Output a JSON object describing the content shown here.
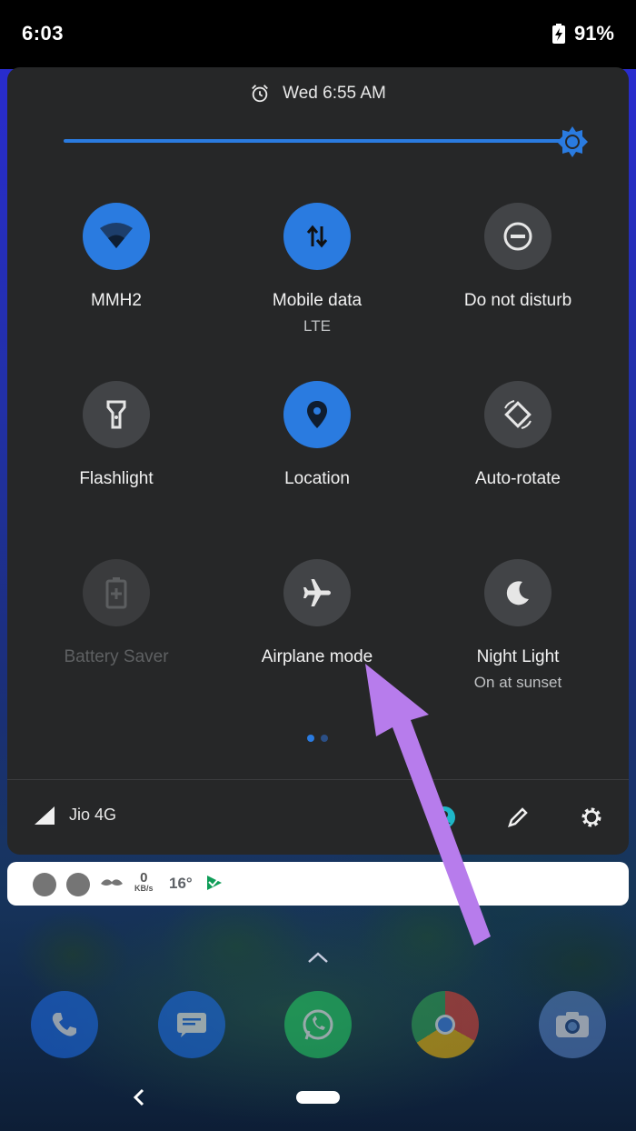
{
  "status_bar": {
    "time": "6:03",
    "battery": "91%"
  },
  "quick_settings": {
    "alarm": "Wed 6:55 AM",
    "brightness_level": 0.97,
    "tiles": [
      {
        "label": "MMH2",
        "sub": "",
        "icon": "wifi-icon",
        "state": "on"
      },
      {
        "label": "Mobile data",
        "sub": "LTE",
        "icon": "mobile-data-icon",
        "state": "on"
      },
      {
        "label": "Do not disturb",
        "sub": "",
        "icon": "do-not-disturb-icon",
        "state": "off"
      },
      {
        "label": "Flashlight",
        "sub": "",
        "icon": "flashlight-icon",
        "state": "off"
      },
      {
        "label": "Location",
        "sub": "",
        "icon": "location-icon",
        "state": "on"
      },
      {
        "label": "Auto-rotate",
        "sub": "",
        "icon": "auto-rotate-icon",
        "state": "off"
      },
      {
        "label": "Battery Saver",
        "sub": "",
        "icon": "battery-saver-icon",
        "state": "unavailable"
      },
      {
        "label": "Airplane mode",
        "sub": "",
        "icon": "airplane-icon",
        "state": "off"
      },
      {
        "label": "Night Light",
        "sub": "On at sunset",
        "icon": "moon-icon",
        "state": "off"
      }
    ],
    "page_count": 2,
    "active_page": 1,
    "footer": {
      "carrier": "Jio 4G"
    }
  },
  "notification_strip": {
    "speed_value": "0",
    "speed_unit": "KB/s",
    "temperature": "16°"
  },
  "colors": {
    "accent": "#2a7be0",
    "panel": "#262728",
    "arrow": "#b77cec"
  }
}
